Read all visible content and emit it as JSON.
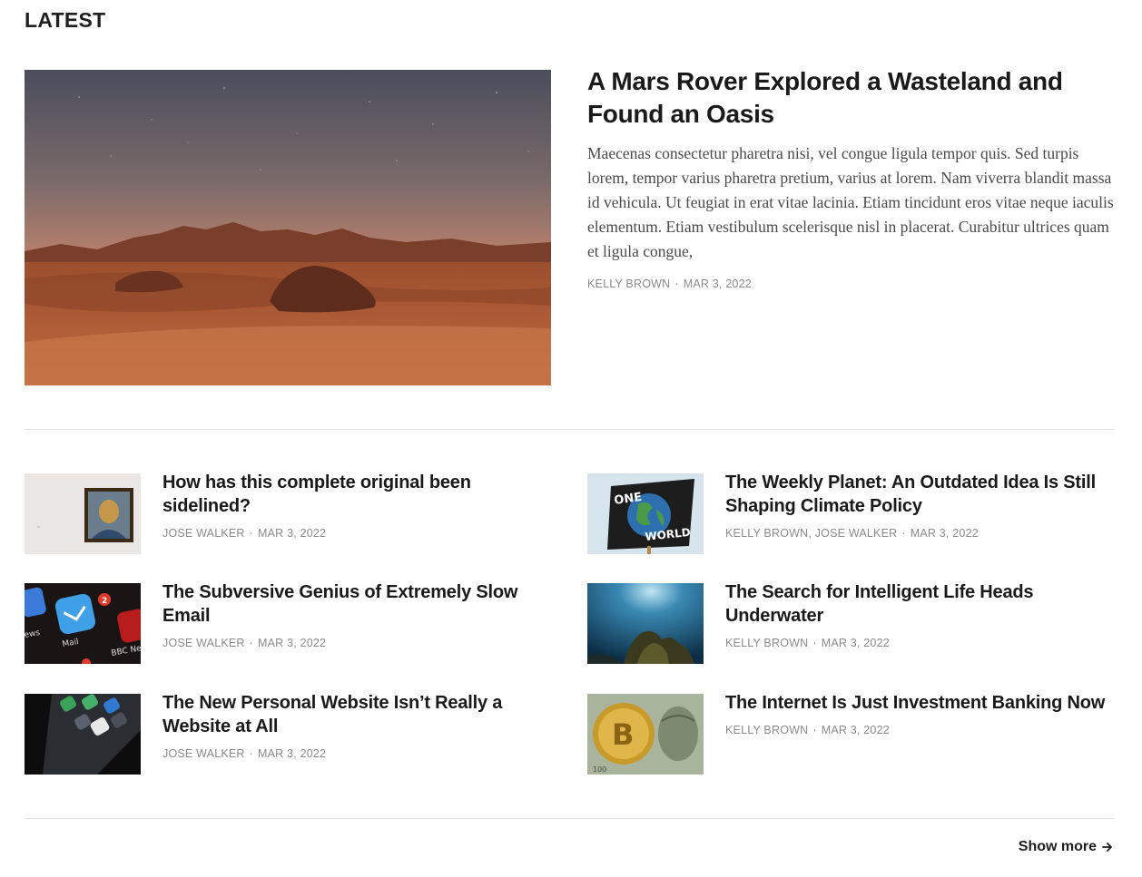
{
  "section": {
    "title": "LATEST"
  },
  "featured": {
    "title": "A Mars Rover Explored a Wasteland and Found an Oasis",
    "excerpt": "Maecenas consectetur pharetra nisi, vel congue ligula tempor quis. Sed turpis lorem, tempor varius pharetra pretium, varius at lorem. Nam viverra blandit massa id vehicula. Ut feugiat in erat vitae lacinia. Etiam tincidunt eros vitae neque iaculis elementum. Etiam vestibulum scelerisque nisl in placerat. Curabitur ultrices quam et ligula congue,",
    "author": "KELLY BROWN",
    "date": "MAR 3, 2022",
    "image": "desert-landscape"
  },
  "posts": [
    {
      "title": "How has this complete original been sidelined?",
      "author": "JOSE WALKER",
      "date": "MAR 3, 2022",
      "image": "framed-portrait"
    },
    {
      "title": "The Weekly Planet: An Outdated Idea Is Still Shaping Climate Policy",
      "author": "KELLY BROWN, JOSE WALKER",
      "date": "MAR 3, 2022",
      "image": "one-world-sign"
    },
    {
      "title": "The Subversive Genius of Extremely Slow Email",
      "author": "JOSE WALKER",
      "date": "MAR 3, 2022",
      "image": "phone-mail-apps"
    },
    {
      "title": "The Search for Intelligent Life Heads Underwater",
      "author": "KELLY BROWN",
      "date": "MAR 3, 2022",
      "image": "underwater-reef"
    },
    {
      "title": "The New Personal Website Isn’t Really a Website at All",
      "author": "JOSE WALKER",
      "date": "MAR 3, 2022",
      "image": "phone-dark-apps"
    },
    {
      "title": "The Internet Is Just Investment Banking Now",
      "author": "KELLY BROWN",
      "date": "MAR 3, 2022",
      "image": "bitcoin-dollar"
    }
  ],
  "footer": {
    "show_more": "Show more",
    "arrow_icon": "arrow-right-icon"
  }
}
